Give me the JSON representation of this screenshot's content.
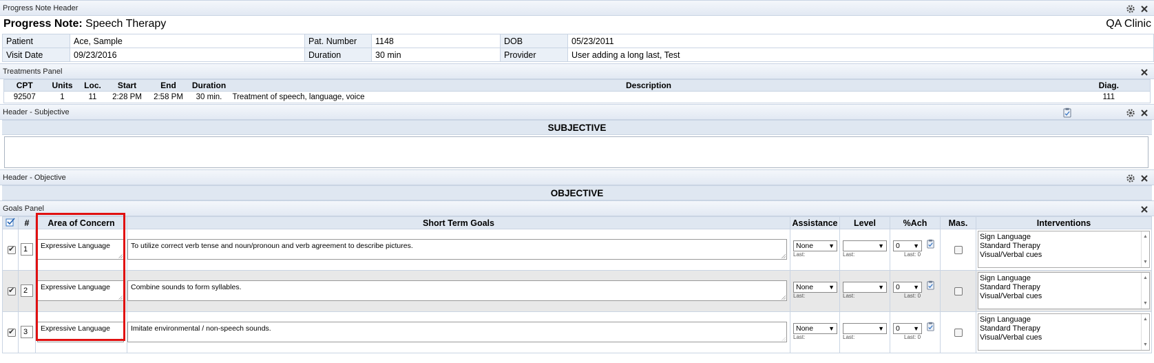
{
  "progress_header": {
    "bar_title": "Progress Note Header",
    "title_label": "Progress Note:",
    "title_value": "Speech Therapy",
    "clinic": "QA Clinic",
    "rows": [
      [
        {
          "label": "Patient",
          "value": "Ace, Sample"
        },
        {
          "label": "Pat. Number",
          "value": "1148"
        },
        {
          "label": "DOB",
          "value": "05/23/2011"
        }
      ],
      [
        {
          "label": "Visit Date",
          "value": "09/23/2016"
        },
        {
          "label": "Duration",
          "value": "30 min"
        },
        {
          "label": "Provider",
          "value": "User adding a long last, Test"
        }
      ]
    ]
  },
  "treatments": {
    "bar_title": "Treatments Panel",
    "columns": [
      "CPT",
      "Units",
      "Loc.",
      "Start",
      "End",
      "Duration",
      "Description",
      "Diag."
    ],
    "rows": [
      [
        "92507",
        "1",
        "11",
        "2:28 PM",
        "2:58 PM",
        "30 min.",
        "Treatment of speech, language, voice",
        "111"
      ]
    ]
  },
  "subjective": {
    "bar_title": "Header - Subjective",
    "heading": "SUBJECTIVE"
  },
  "objective": {
    "bar_title": "Header - Objective",
    "heading": "OBJECTIVE"
  },
  "goals": {
    "bar_title": "Goals Panel",
    "columns": [
      "#",
      "Area of Concern",
      "Short Term Goals",
      "Assistance",
      "Level",
      "%Ach",
      "Mas.",
      "Interventions"
    ],
    "rows": [
      {
        "checked": true,
        "num": "1",
        "area": "Expressive Language",
        "goal": "To utilize correct verb tense and noun/pronoun and verb agreement to describe pictures.",
        "assistance": "None",
        "assistance_last": "Last:",
        "level": "",
        "level_last": "Last:",
        "ach": "0",
        "ach_last": "Last: 0",
        "mastered": false,
        "interventions": [
          "Sign Language",
          "Standard Therapy",
          "Visual/Verbal cues"
        ]
      },
      {
        "checked": true,
        "num": "2",
        "area": "Expressive Language",
        "goal": "Combine sounds to form syllables.",
        "assistance": "None",
        "assistance_last": "Last:",
        "level": "",
        "level_last": "Last:",
        "ach": "0",
        "ach_last": "Last: 0",
        "mastered": false,
        "interventions": [
          "Sign Language",
          "Standard Therapy",
          "Visual/Verbal cues"
        ]
      },
      {
        "checked": true,
        "num": "3",
        "area": "Expressive Language",
        "goal": "Imitate environmental / non-speech sounds.",
        "assistance": "None",
        "assistance_last": "Last:",
        "level": "",
        "level_last": "Last:",
        "ach": "0",
        "ach_last": "Last: 0",
        "mastered": false,
        "interventions": [
          "Sign Language",
          "Standard Therapy",
          "Visual/Verbal cues"
        ]
      }
    ]
  },
  "icons": {
    "gear": "gear-icon",
    "close": "close-icon",
    "clipboard": "clipboard-icon",
    "check_all": "check-all-icon"
  },
  "colors": {
    "panel_bar": "#e2e9f3",
    "section_head": "#dfe7f1",
    "highlight": "#e01010"
  }
}
